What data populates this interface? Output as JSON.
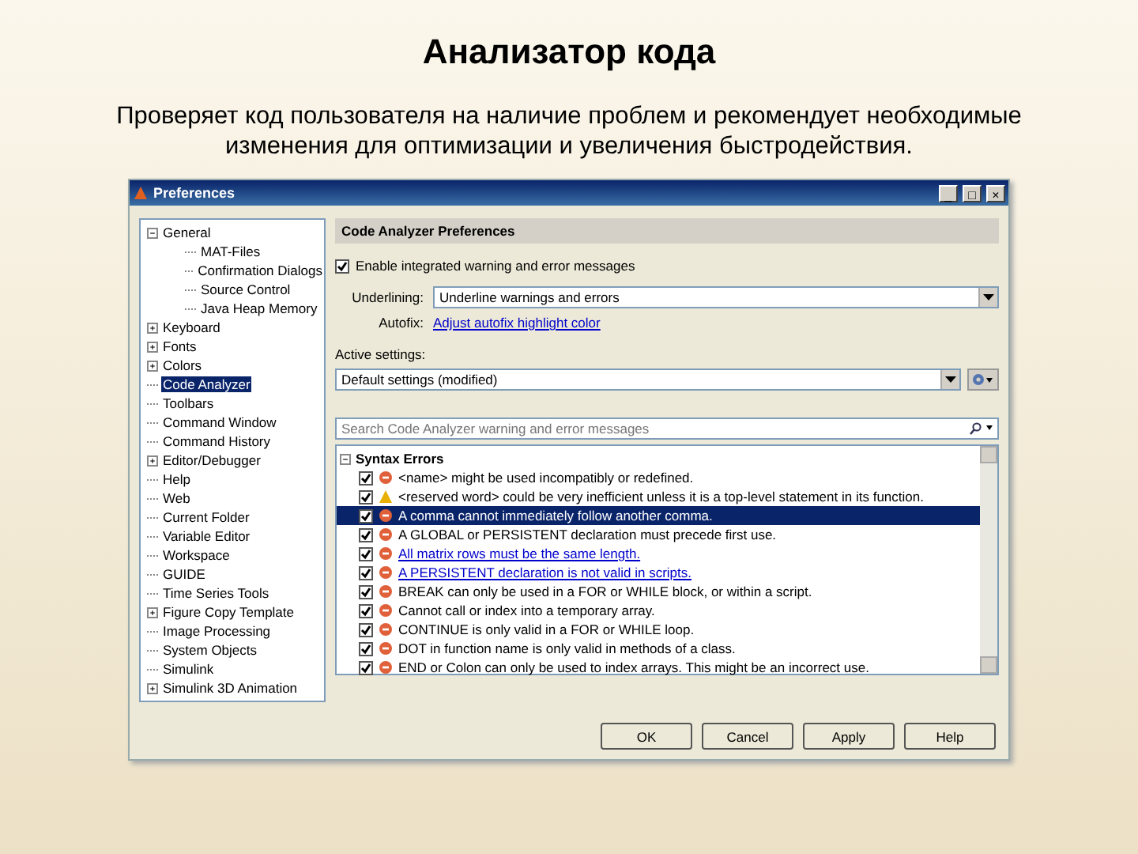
{
  "slide": {
    "title": "Анализатор кода",
    "subtitle": "Проверяет код пользователя на наличие проблем и рекомендует необходимые изменения для оптимизации и увеличения быстродействия."
  },
  "window": {
    "title": "Preferences",
    "controls": [
      "_",
      "□",
      "×"
    ]
  },
  "tree": [
    {
      "label": "General",
      "expanded": true,
      "selected": false,
      "children": [
        {
          "label": "MAT-Files",
          "selected": false
        },
        {
          "label": "Confirmation Dialogs",
          "selected": false
        },
        {
          "label": "Source Control",
          "selected": false
        },
        {
          "label": "Java Heap Memory",
          "selected": false
        }
      ]
    },
    {
      "label": "Keyboard",
      "expanded": false,
      "selected": false
    },
    {
      "label": "Fonts",
      "expanded": false,
      "selected": false
    },
    {
      "label": "Colors",
      "expanded": false,
      "selected": false
    },
    {
      "label": "Code Analyzer",
      "selected": true
    },
    {
      "label": "Toolbars",
      "selected": false
    },
    {
      "label": "Command Window",
      "selected": false
    },
    {
      "label": "Command History",
      "selected": false
    },
    {
      "label": "Editor/Debugger",
      "expanded": false,
      "selected": false
    },
    {
      "label": "Help",
      "selected": false
    },
    {
      "label": "Web",
      "selected": false
    },
    {
      "label": "Current Folder",
      "selected": false
    },
    {
      "label": "Variable Editor",
      "selected": false
    },
    {
      "label": "Workspace",
      "selected": false
    },
    {
      "label": "GUIDE",
      "selected": false
    },
    {
      "label": "Time Series Tools",
      "selected": false
    },
    {
      "label": "Figure Copy Template",
      "expanded": false,
      "selected": false
    },
    {
      "label": "Image Processing",
      "selected": false
    },
    {
      "label": "System Objects",
      "selected": false
    },
    {
      "label": "Simulink",
      "selected": false
    },
    {
      "label": "Simulink 3D Animation",
      "expanded": false,
      "selected": false
    }
  ],
  "panel": {
    "header": "Code Analyzer Preferences",
    "enable": {
      "label": "Enable integrated warning and error messages",
      "checked": true
    },
    "underlining": {
      "label": "Underlining:",
      "value": "Underline warnings and errors"
    },
    "autofix": {
      "label": "Autofix:",
      "link": "Adjust autofix highlight color"
    },
    "active_settings": {
      "label": "Active settings:",
      "value": "Default settings (modified)"
    },
    "search": {
      "placeholder": "Search Code Analyzer warning and error messages"
    },
    "category": {
      "label": "Syntax Errors",
      "expanded": true
    },
    "messages": [
      {
        "kind": "error",
        "text": "<name> might be used incompatibly or redefined.",
        "checked": true,
        "selected": false,
        "link": false
      },
      {
        "kind": "warning",
        "text": "<reserved word> could be very inefficient unless it is a top-level statement in its function.",
        "checked": true,
        "selected": false,
        "link": false
      },
      {
        "kind": "error",
        "text": "A comma cannot immediately follow another comma.",
        "checked": true,
        "selected": true,
        "link": false
      },
      {
        "kind": "error",
        "text": "A GLOBAL or PERSISTENT declaration must precede first use.",
        "checked": true,
        "selected": false,
        "link": false
      },
      {
        "kind": "error",
        "text": "All matrix rows must be the same length.",
        "checked": true,
        "selected": false,
        "link": true
      },
      {
        "kind": "error",
        "text": "A PERSISTENT declaration is not valid in scripts.",
        "checked": true,
        "selected": false,
        "link": true
      },
      {
        "kind": "error",
        "text": "BREAK can only be used in a FOR or WHILE block, or within a script.",
        "checked": true,
        "selected": false,
        "link": false
      },
      {
        "kind": "error",
        "text": "Cannot call or index into a temporary array.",
        "checked": true,
        "selected": false,
        "link": false
      },
      {
        "kind": "error",
        "text": "CONTINUE is only valid in a FOR or WHILE loop.",
        "checked": true,
        "selected": false,
        "link": false
      },
      {
        "kind": "error",
        "text": "DOT in function name is only valid in methods of a class.",
        "checked": true,
        "selected": false,
        "link": false
      },
      {
        "kind": "error",
        "text": "END or Colon can only be used to index arrays. This might be an incorrect use.",
        "checked": true,
        "selected": false,
        "link": false
      }
    ]
  },
  "buttons": [
    "OK",
    "Cancel",
    "Apply",
    "Help"
  ]
}
